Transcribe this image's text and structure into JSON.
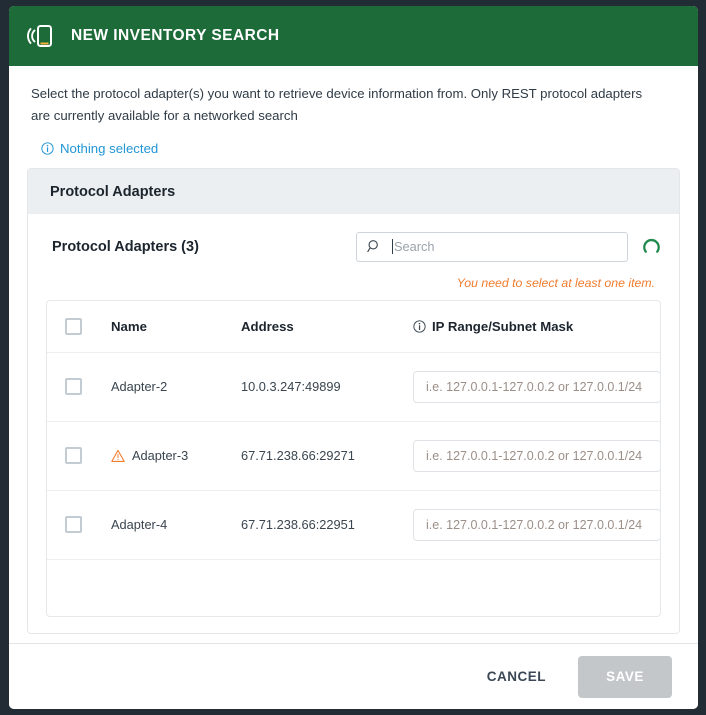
{
  "header": {
    "title": "NEW INVENTORY SEARCH",
    "icon": "mobile-device-signal-icon",
    "background_color": "#1d6b38"
  },
  "body": {
    "description": "Select the protocol adapter(s) you want to retrieve device information from. Only REST protocol adapters are currently available for a networked search",
    "selection_status": {
      "icon": "info-circle-icon",
      "label": "Nothing selected",
      "color": "#2196d6"
    }
  },
  "panel": {
    "title": "Protocol Adapters",
    "subtitle": "Protocol Adapters (3)",
    "search": {
      "icon": "search-icon",
      "placeholder": "Search",
      "value": ""
    },
    "spinner": {
      "icon": "loading-spinner-icon",
      "color": "#1f8a4c"
    },
    "validation_message": "You need to select at least one item.",
    "validation_color": "#f07c2e"
  },
  "table": {
    "columns": {
      "select_all": "",
      "name": "Name",
      "address": "Address",
      "ip_range": "IP Range/Subnet Mask",
      "ip_range_icon": "info-circle-icon"
    },
    "rows": [
      {
        "checked": false,
        "warning": false,
        "name": "Adapter-2",
        "address": "10.0.3.247:49899",
        "ip_range_value": "",
        "ip_range_placeholder": "i.e. 127.0.0.1-127.0.0.2 or 127.0.0.1/24"
      },
      {
        "checked": false,
        "warning": true,
        "warning_icon": "warning-triangle-icon",
        "name": "Adapter-3",
        "address": "67.71.238.66:29271",
        "ip_range_value": "",
        "ip_range_placeholder": "i.e. 127.0.0.1-127.0.0.2 or 127.0.0.1/24"
      },
      {
        "checked": false,
        "warning": false,
        "name": "Adapter-4",
        "address": "67.71.238.66:22951",
        "ip_range_value": "",
        "ip_range_placeholder": "i.e. 127.0.0.1-127.0.0.2 or 127.0.0.1/24"
      }
    ]
  },
  "footer": {
    "cancel_label": "CANCEL",
    "save_label": "SAVE",
    "save_disabled": true
  }
}
